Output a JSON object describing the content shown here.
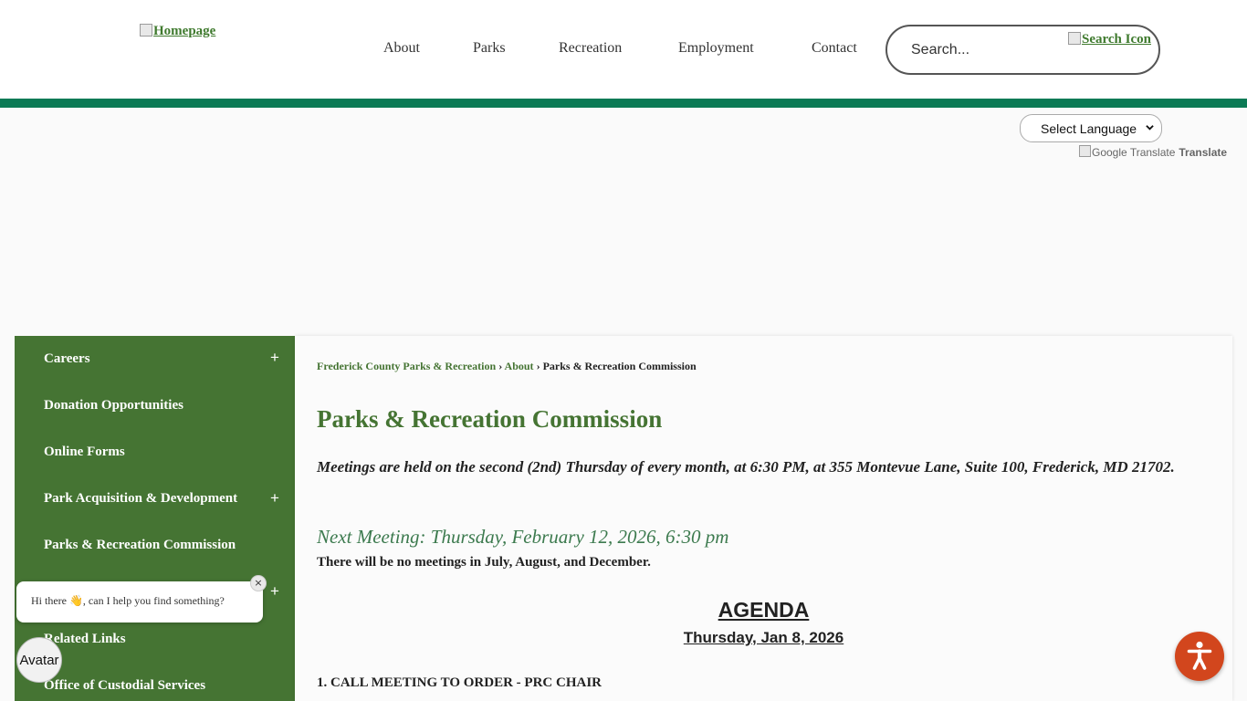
{
  "header": {
    "logo_alt": "Homepage",
    "nav": [
      "About",
      "Parks",
      "Recreation",
      "Employment",
      "Contact"
    ],
    "search": {
      "placeholder": "Search...",
      "icon_alt": "Search Icon"
    }
  },
  "language": {
    "select_label": "Select Language",
    "google_logo_alt": "Google Translate",
    "translate_label": "Translate"
  },
  "sidebar": {
    "items": [
      {
        "label": "Careers",
        "expandable": true
      },
      {
        "label": "Donation Opportunities",
        "expandable": false
      },
      {
        "label": "Online Forms",
        "expandable": false
      },
      {
        "label": "Park Acquisition & Development",
        "expandable": true
      },
      {
        "label": "Parks & Recreation Commission",
        "expandable": false
      },
      {
        "label": "",
        "expandable": true
      },
      {
        "label": "Related Links",
        "expandable": false
      },
      {
        "label": "Office of Custodial Services",
        "expandable": false
      }
    ],
    "plus_symbol": "+"
  },
  "breadcrumb": {
    "items": [
      "Frederick County Parks & Recreation",
      "About"
    ],
    "separator": "›",
    "current": "Parks & Recreation Commission"
  },
  "main": {
    "title": "Parks & Recreation Commission",
    "intro": "Meetings are held on the second (2nd) Thursday of every month, at 6:30 PM, at 355 Montevue Lane, Suite 100, Frederick, MD 21702.",
    "next_meeting": "Next Meeting: Thursday, February 12, 2026, 6:30 pm",
    "no_meetings": "There will be no meetings in July, August, and December.",
    "agenda_title": "AGENDA",
    "agenda_date": "Thursday, Jan 8, 2026",
    "agenda_items": [
      "1. CALL MEETING TO ORDER - PRC CHAIR"
    ]
  },
  "chat": {
    "message": "Hi there 👋, can I help you find something?",
    "close": "×",
    "avatar_label": "Avatar"
  },
  "colors": {
    "brand_green": "#457433",
    "header_bar": "#0b7a55",
    "next_meeting": "#3c7a4e",
    "a11y_button": "#d2461d"
  },
  "icons": {
    "accessibility": "accessibility-person-icon",
    "dropdown": "chevron-down-icon"
  }
}
